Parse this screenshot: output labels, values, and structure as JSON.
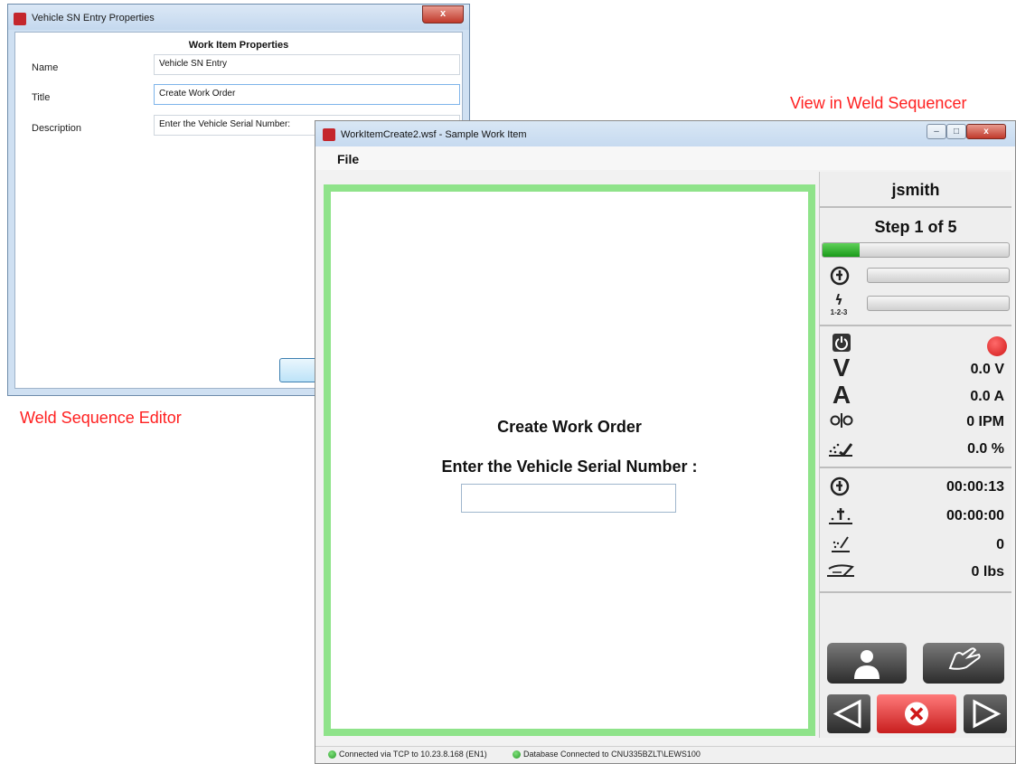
{
  "editor": {
    "window_title": "Vehicle SN Entry Properties",
    "close_label": "x",
    "section_title": "Work Item Properties",
    "fields": [
      {
        "label": "Name",
        "value": "Vehicle SN Entry"
      },
      {
        "label": "Title",
        "value": "Create Work Order"
      },
      {
        "label": "Description",
        "value": "Enter the Vehicle Serial Number:"
      }
    ]
  },
  "captions": {
    "editor": "Weld Sequence Editor",
    "sequencer": "View in Weld Sequencer"
  },
  "sequencer": {
    "window_title": "WorkItemCreate2.wsf - Sample Work Item",
    "window_buttons": {
      "minimize": "–",
      "maximize": "□",
      "close": "x"
    },
    "menu": {
      "file": "File"
    },
    "prompt": {
      "title": "Create Work Order",
      "label": "Enter the Vehicle Serial Number :",
      "input_value": ""
    },
    "panel": {
      "user": "jsmith",
      "step": "Step 1 of 5",
      "step_progress": 0.2,
      "step_icon_label": "1-2-3",
      "voltage": "0.0 V",
      "current": "0.0 A",
      "wire_speed": "0 IPM",
      "percent": "0.0 %",
      "time_elapsed": "00:00:13",
      "time_weld": "00:00:00",
      "count": "0",
      "weight": "0 lbs",
      "icons": {
        "voltage": "V",
        "current": "A"
      }
    },
    "status": {
      "tcp": "Connected via TCP to 10.23.8.168 (EN1)",
      "database": "Database Connected to CNU335BZLT\\LEWS100"
    }
  }
}
